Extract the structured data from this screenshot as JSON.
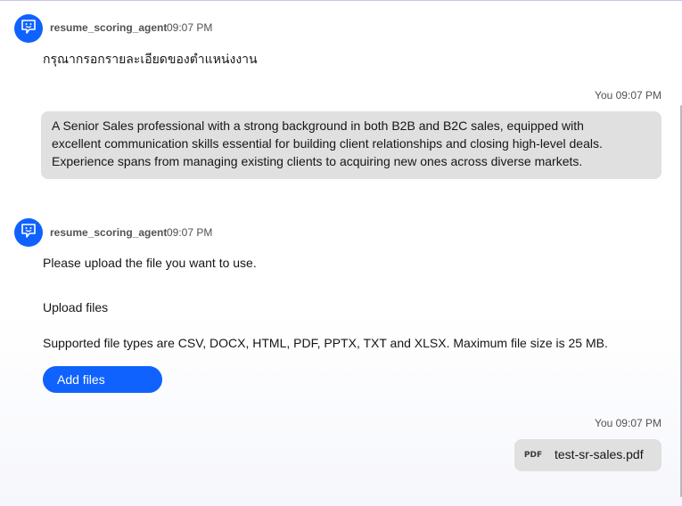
{
  "messages": {
    "agent1": {
      "name": "resume_scoring_agent",
      "time": "09:07 PM",
      "text": "กรุณากรอกรายละเอียดของตำแหน่งงาน"
    },
    "user1": {
      "meta": "You 09:07 PM",
      "lines": [
        "A Senior Sales professional with a strong background in both B2B and B2C sales, equipped with",
        "excellent communication skills essential for building client relationships and closing high-level deals.",
        "Experience spans from managing existing clients to acquiring new ones across diverse markets."
      ]
    },
    "agent2": {
      "name": "resume_scoring_agent",
      "time": "09:07 PM",
      "prompt": "Please upload the file you want to use.",
      "upload_label": "Upload files",
      "supported": "Supported file types are CSV, DOCX, HTML, PDF, PPTX, TXT and XLSX. Maximum file size is 25 MB.",
      "add_files_label": "Add files"
    },
    "user2": {
      "meta": "You 09:07 PM",
      "file_type": "PDF",
      "file_name": "test-sr-sales.pdf"
    }
  },
  "icons": {
    "agent_avatar": "chat-bot-icon"
  },
  "colors": {
    "accent": "#0f62fe",
    "user_bubble": "#e0e0e0",
    "text": "#161616",
    "muted": "#525252"
  }
}
